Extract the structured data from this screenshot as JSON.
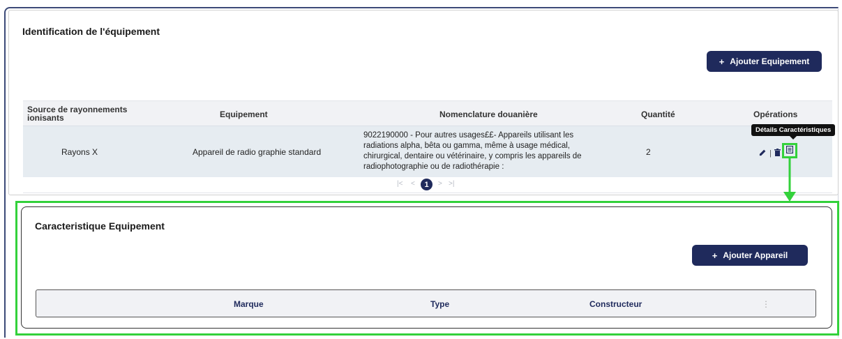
{
  "section1": {
    "title": "Identification de l'équipement",
    "add_button": "Ajouter Equipement",
    "columns": [
      "Source de rayonnements ionisants",
      "Equipement",
      "Nomenclature douanière",
      "Quantité",
      "Opérations"
    ],
    "rows": [
      {
        "source": "Rayons X",
        "equipement": "Appareil de radio graphie standard",
        "nomenclature": "9022190000 - Pour autres usages££- Appareils utilisant les radiations alpha, bêta ou gamma, même à usage médical, chirurgical, dentaire ou vétérinaire, y compris les appareils de radiophotographie ou de radiothérapie :",
        "quantite": "2",
        "ops_separator": "|"
      }
    ],
    "pagination": {
      "first": "|<",
      "prev": "<",
      "current": "1",
      "next": ">",
      "last": ">|"
    },
    "tooltip": "Détails Caractéristiques"
  },
  "section2": {
    "title": "Caracteristique Equipement",
    "add_button": "Ajouter Appareil",
    "columns": [
      "Marque",
      "Type",
      "Constructeur"
    ],
    "more": "⋮"
  },
  "icons": [
    "edit-icon",
    "delete-icon",
    "details-icon",
    "plus-icon",
    "arrow-down-icon"
  ],
  "colors": {
    "primary": "#1f2a5c",
    "highlight": "#33d13b",
    "row_bg": "#e6ecf1",
    "header_bg": "#f1f2f5"
  }
}
